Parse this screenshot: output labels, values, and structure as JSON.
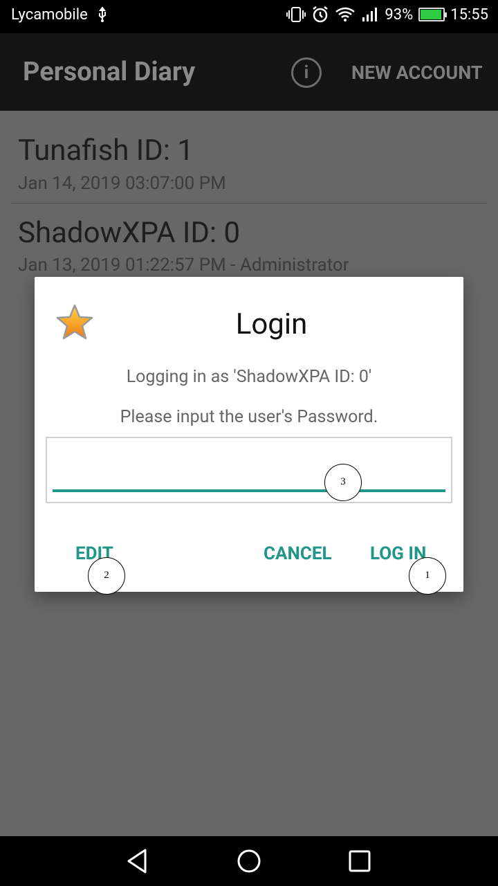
{
  "status_bar": {
    "carrier": "Lycamobile",
    "battery_percent": "93%",
    "time": "15:55",
    "icons": [
      "usb-icon",
      "vibrate-icon",
      "alarm-icon",
      "wifi-icon",
      "signal-icon",
      "battery-icon"
    ]
  },
  "app_bar": {
    "title": "Personal Diary",
    "info_icon": "i",
    "new_account_label": "NEW ACCOUNT"
  },
  "list": {
    "items": [
      {
        "name": "Tunafish ID: 1",
        "meta": "Jan 14, 2019 03:07:00 PM"
      },
      {
        "name": "ShadowXPA ID: 0",
        "meta": "Jan 13, 2019 01:22:57 PM - Administrator"
      }
    ]
  },
  "dialog": {
    "icon": "star-icon",
    "title": "Login",
    "line1": "Logging in as 'ShadowXPA ID: 0'",
    "line2": "Please input the user's Password.",
    "password_value": "",
    "buttons": {
      "edit": "EDIT",
      "cancel": "CANCEL",
      "login": "LOG IN"
    }
  },
  "markers": [
    "1",
    "2",
    "3"
  ],
  "colors": {
    "accent": "#1f9688",
    "scrim": "#676767"
  }
}
